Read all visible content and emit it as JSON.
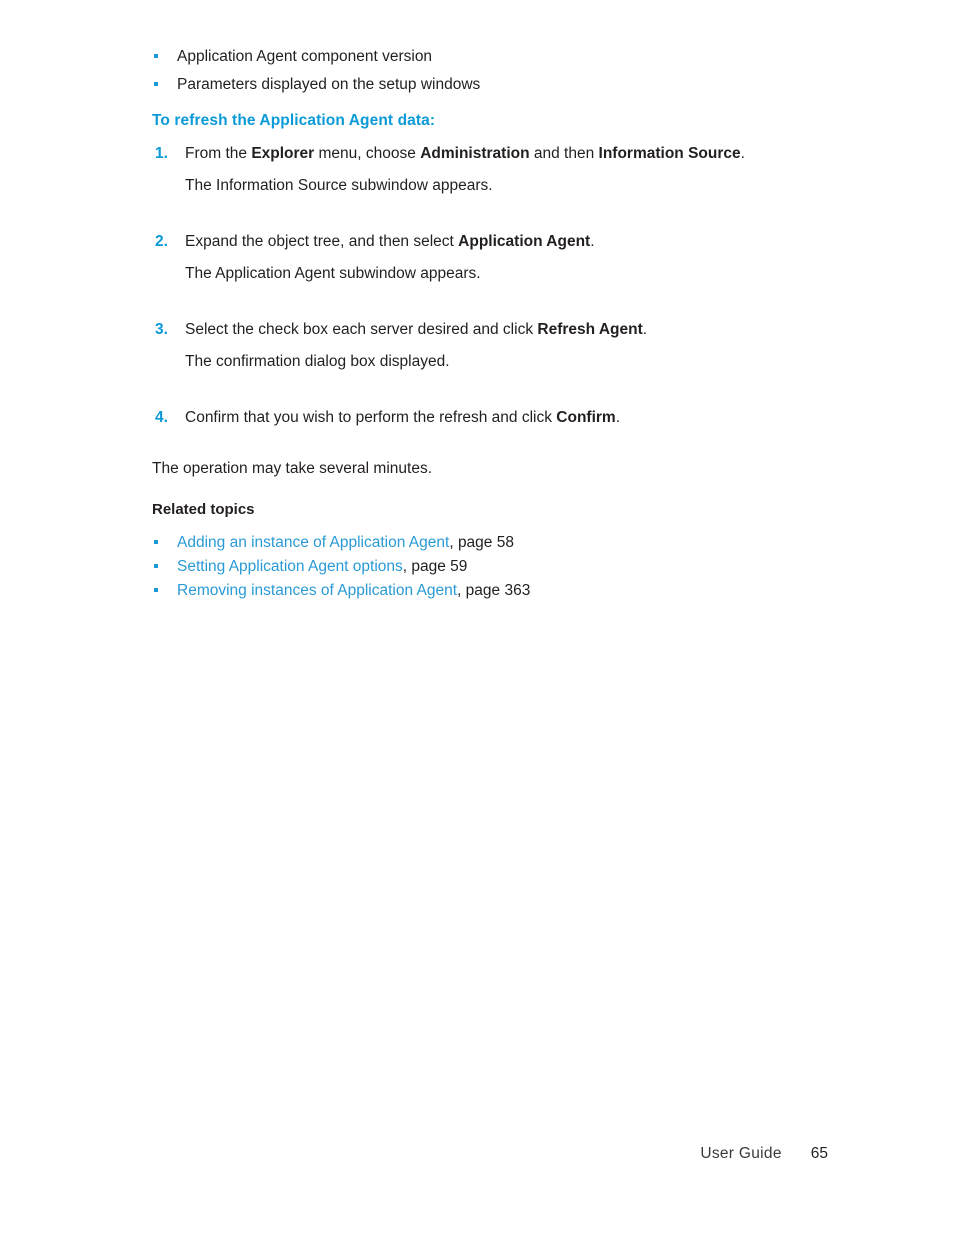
{
  "page": {
    "background_color": "#ffffff",
    "text_color": "#231f20",
    "accent_color": "#0b9ad8",
    "link_color": "#2a9ad5",
    "bullet_color": "#1b9ad7"
  },
  "intro_bullets": [
    {
      "text": "Application Agent component version"
    },
    {
      "text": "Parameters displayed on the setup windows"
    }
  ],
  "section": {
    "heading": "To refresh the Application Agent data:"
  },
  "steps": [
    {
      "number": "1.",
      "parts": [
        {
          "text": "From the ",
          "bold": false
        },
        {
          "text": "Explorer",
          "bold": true
        },
        {
          "text": " menu, choose ",
          "bold": false
        },
        {
          "text": "Administration",
          "bold": true
        },
        {
          "text": " and then ",
          "bold": false
        },
        {
          "text": "Information Source",
          "bold": true
        },
        {
          "text": ".",
          "bold": false
        }
      ],
      "result": "The Information Source subwindow appears."
    },
    {
      "number": "2.",
      "parts": [
        {
          "text": "Expand the object tree, and then select ",
          "bold": false
        },
        {
          "text": "Application Agent",
          "bold": true
        },
        {
          "text": ".",
          "bold": false
        }
      ],
      "result": "The Application Agent subwindow appears."
    },
    {
      "number": "3.",
      "parts": [
        {
          "text": "Select the check box each server desired and click ",
          "bold": false
        },
        {
          "text": "Refresh Agent",
          "bold": true
        },
        {
          "text": ".",
          "bold": false
        }
      ],
      "result": "The confirmation dialog box displayed."
    },
    {
      "number": "4.",
      "parts": [
        {
          "text": "Confirm that you wish to perform the refresh and click ",
          "bold": false
        },
        {
          "text": "Confirm",
          "bold": true
        },
        {
          "text": ".",
          "bold": false
        }
      ],
      "result": ""
    }
  ],
  "trailing_note": "The operation may take several minutes.",
  "related": {
    "heading": "Related topics",
    "items": [
      {
        "link": "Adding an instance of Application Agent",
        "page": ", page 58"
      },
      {
        "link": "Setting Application Agent options",
        "page": ", page 59"
      },
      {
        "link": "Removing instances of Application Agent",
        "page": ", page 363"
      }
    ]
  },
  "footer": {
    "label": "User Guide",
    "page_number": "65"
  }
}
